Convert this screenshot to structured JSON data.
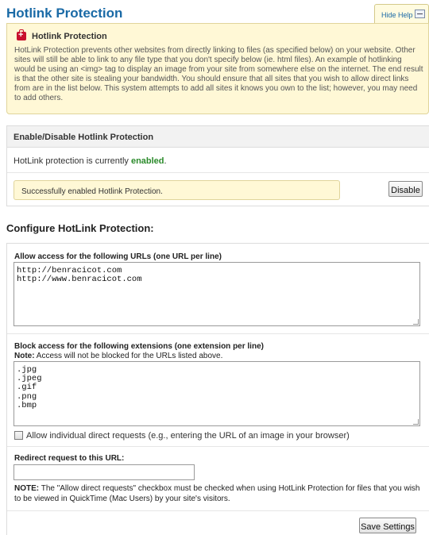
{
  "page": {
    "title": "Hotlink Protection",
    "hide_help_label": "Hide Help"
  },
  "help": {
    "heading": "Hotlink Protection",
    "text": "HotLink Protection prevents other websites from directly linking to files (as specified below) on your website. Other sites will still be able to link to any file type that you don't specify below (ie. html files). An example of hotlinking would be using an <img> tag to display an image from your site from somewhere else on the internet. The end result is that the other site is stealing your bandwidth. You should ensure that all sites that you wish to allow direct links from are in the list below. This system attempts to add all sites it knows you own to the list; however, you may need to add others."
  },
  "enable_panel": {
    "header": "Enable/Disable Hotlink Protection",
    "status_prefix": "HotLink protection is currently ",
    "status_value": "enabled",
    "status_suffix": ".",
    "success_message": "Successfully enabled Hotlink Protection.",
    "disable_button": "Disable"
  },
  "config": {
    "title": "Configure HotLink Protection:",
    "allow_urls_label": "Allow access for the following URLs (one URL per line)",
    "allow_urls": [
      "http://benracicot.com",
      "http://www.benracicot.com"
    ],
    "block_ext_label": "Block access for the following extensions (one extension per line)",
    "block_note_prefix": "Note:",
    "block_note_text": " Access will not be blocked for the URLs listed above.",
    "extensions": [
      ".jpg",
      ".jpeg",
      ".gif",
      ".png",
      ".bmp"
    ],
    "allow_direct_label": "Allow individual direct requests (e.g., entering the URL of an image in your browser)",
    "allow_direct_checked": false,
    "redirect_label": "Redirect request to this URL:",
    "redirect_value": "",
    "bottom_note_prefix": "NOTE:",
    "bottom_note_text": " The \"Allow direct requests\" checkbox must be checked when using HotLink Protection for files that you wish to be viewed in QuickTime (Mac Users) by your site's visitors.",
    "save_button": "Save Settings"
  },
  "colors": {
    "title_blue": "#1a6aa6",
    "help_bg": "#fff8d6",
    "enabled_green": "#2a8a2a"
  }
}
